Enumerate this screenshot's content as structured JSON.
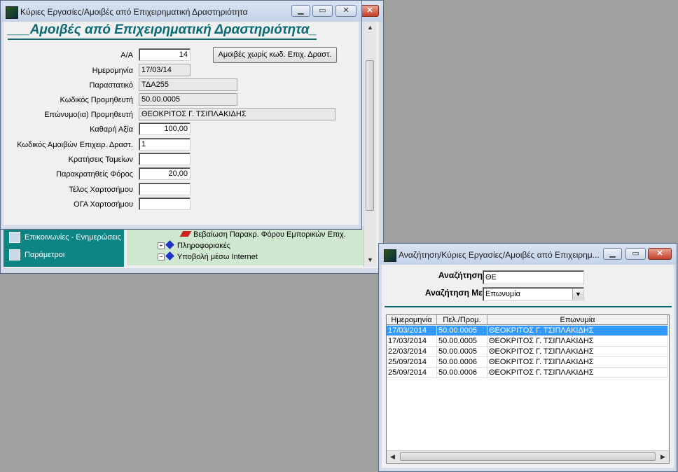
{
  "main_window": {
    "title": "Κύριες Εργασίες/Αμοιβές από Επιχειρηματική Δραστηριότητα",
    "heading": "Αμοιβές από Επιχειρηματική Δραστηριότητα",
    "heading_prefix": "___",
    "heading_suffix": "_",
    "fields": {
      "aa_label": "Α/Α",
      "aa_value": "14",
      "date_label": "Ημερομηνία",
      "date_value": "17/03/14",
      "doc_label": "Παραστατικό",
      "doc_value": "ΤΔΑ255",
      "code_label": "Κωδικός Προμηθευτή",
      "code_value": "50.00.0005",
      "name_label": "Επώνυμο(ια) Προμηθευτή",
      "name_value": "ΘΕΟΚΡΙΤΟΣ Γ. ΤΣΙΠΛΑΚΙΔΗΣ",
      "net_label": "Καθαρή Αξία",
      "net_value": "100,00",
      "feecode_label": "Κωδικός Αμοιβών Επιχειρ. Δραστ.",
      "feecode_value": "1",
      "deduct_label": "Κρατήσεις Ταμείων",
      "deduct_value": "",
      "tax_label": "Παρακρατηθείς Φόρος",
      "tax_value": "20,00",
      "stamp_label": "Τέλος Χαρτοσήμου",
      "stamp_value": "",
      "oga_label": "ΟΓΑ Χαρτοσήμου",
      "oga_value": ""
    },
    "no_code_button": "Αμοιβές χωρίς κωδ. Επιχ. Δραστ."
  },
  "background": {
    "nav": [
      "Επικοινωνίες - Ενημερώσεις",
      "Παράμετροι"
    ],
    "tree": [
      {
        "label": "Βεβαίωση Παρακρ. Φόρου Εμπορικών Επιχ.",
        "icon": "pencil-icon"
      },
      {
        "label": "Πληροφοριακές",
        "icon": "diamond-icon",
        "expander": "+"
      },
      {
        "label": "Υποβολή μέσω Internet",
        "icon": "diamond-icon",
        "expander": "−"
      }
    ]
  },
  "search_window": {
    "title": "Αναζήτηση/Κύριες Εργασίες/Αμοιβές από Επιχειρημ...",
    "search_label": "Αναζήτηση",
    "search_value": "ΘΕ",
    "search_by_label": "Αναζήτηση Με",
    "search_by_value": "Επωνυμία",
    "columns": [
      "Ημερομηνία",
      "Πελ./Προμ.",
      "Επωνυμία"
    ],
    "rows": [
      [
        "17/03/2014",
        "50.00.0005",
        "ΘΕΟΚΡΙΤΟΣ Γ. ΤΣΙΠΛΑΚΙΔΗΣ"
      ],
      [
        "17/03/2014",
        "50.00.0005",
        "ΘΕΟΚΡΙΤΟΣ Γ. ΤΣΙΠΛΑΚΙΔΗΣ"
      ],
      [
        "22/03/2014",
        "50.00.0005",
        "ΘΕΟΚΡΙΤΟΣ Γ. ΤΣΙΠΛΑΚΙΔΗΣ"
      ],
      [
        "25/09/2014",
        "50.00.0006",
        "ΘΕΟΚΡΙΤΟΣ Γ. ΤΣΙΠΛΑΚΙΔΗΣ"
      ],
      [
        "25/09/2014",
        "50.00.0006",
        "ΘΕΟΚΡΙΤΟΣ Γ. ΤΣΙΠΛΑΚΙΔΗΣ"
      ]
    ],
    "selected_row": 0
  },
  "colors": {
    "accent": "#0b6b74",
    "nav_bg": "#0e8585",
    "selection": "#3399ff"
  }
}
